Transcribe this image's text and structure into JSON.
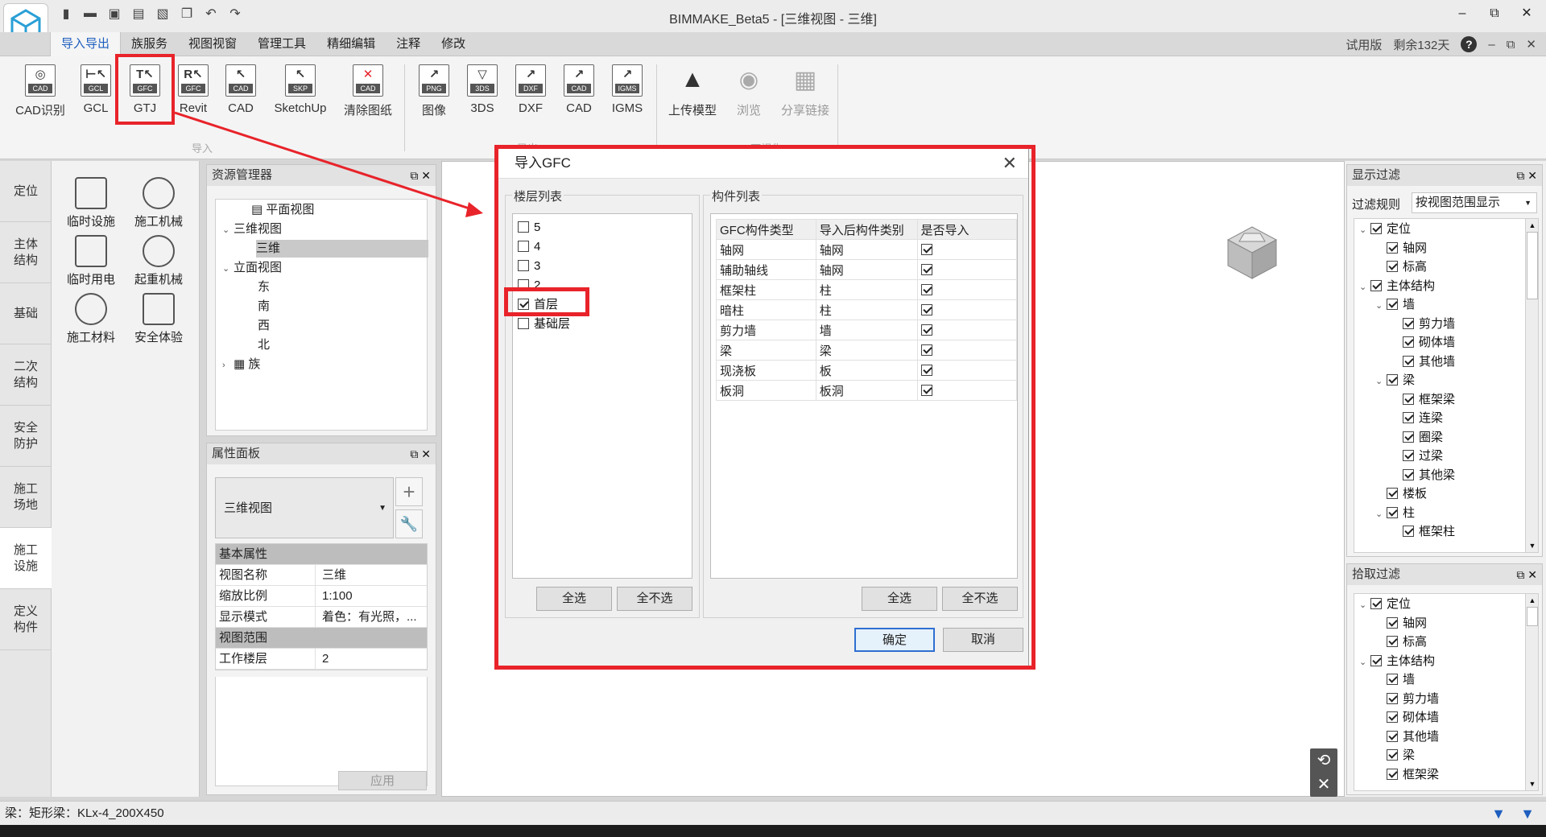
{
  "window": {
    "title": "BIMMAKE_Beta5 - [三维视图 - 三维]",
    "controls": [
      "–",
      "⧉",
      "✕"
    ]
  },
  "ribbon_tabs": [
    "导入导出",
    "族服务",
    "视图视窗",
    "管理工具",
    "精细编辑",
    "注释",
    "修改"
  ],
  "tab_right": {
    "edition": "试用版",
    "days_left": "剩余132天",
    "help": "?",
    "min": "–",
    "restore": "⧉",
    "close": "✕"
  },
  "ribbon_groups": {
    "import": {
      "label": "导入",
      "buttons": [
        {
          "label": "CAD识别",
          "tag": "CAD",
          "glyph": "◎"
        },
        {
          "label": "GCL",
          "tag": "GCL",
          "glyph": "⊢↖"
        },
        {
          "label": "GTJ",
          "tag": "GFC",
          "glyph": "T↖"
        },
        {
          "label": "Revit",
          "tag": "GFC",
          "glyph": "R↖"
        },
        {
          "label": "CAD",
          "tag": "CAD",
          "glyph": "↖"
        },
        {
          "label": "SketchUp",
          "tag": "SKP",
          "glyph": "↖"
        },
        {
          "label": "清除图纸",
          "tag": "CAD",
          "glyph": "✕"
        }
      ]
    },
    "export": {
      "label": "导出",
      "buttons": [
        {
          "label": "图像",
          "tag": "PNG",
          "glyph": "↗"
        },
        {
          "label": "3DS",
          "tag": "3DS",
          "glyph": "▽"
        },
        {
          "label": "DXF",
          "tag": "DXF",
          "glyph": "↗"
        },
        {
          "label": "CAD",
          "tag": "CAD",
          "glyph": "↗"
        },
        {
          "label": "IGMS",
          "tag": "IGMS",
          "glyph": "↗"
        }
      ]
    },
    "bimface": {
      "label": "BIMFACE可视化",
      "buttons": [
        {
          "label": "上传模型",
          "glyph": "▲"
        },
        {
          "label": "浏览",
          "glyph": "◉"
        },
        {
          "label": "分享链接",
          "glyph": "▦"
        }
      ]
    }
  },
  "left_tabs": [
    "定位",
    "主体\n结构",
    "基础",
    "二次\n结构",
    "安全\n防护",
    "施工\n场地",
    "施工\n设施",
    "定义\n构件"
  ],
  "tools": [
    "临时设施",
    "施工机械",
    "临时用电",
    "起重机械",
    "施工材料",
    "安全体验"
  ],
  "resource_manager": {
    "title": "资源管理器",
    "buttons": "⧉ ✕",
    "nodes": [
      {
        "label": "平面视图",
        "arrow": ""
      },
      {
        "label": "三维视图",
        "arrow": "⌄"
      },
      {
        "label": "三维",
        "arrow": ""
      },
      {
        "label": "立面视图",
        "arrow": "⌄"
      },
      {
        "label": "东",
        "arrow": ""
      },
      {
        "label": "南",
        "arrow": ""
      },
      {
        "label": "西",
        "arrow": ""
      },
      {
        "label": "北",
        "arrow": ""
      },
      {
        "label": "族",
        "arrow": "›"
      }
    ]
  },
  "properties": {
    "title": "属性面板",
    "buttons": "⧉ ✕",
    "view_select": "三维视图",
    "add": "+",
    "tool": "🔧",
    "section_basic": "基本属性",
    "rows": [
      {
        "k": "视图名称",
        "v": "三维"
      },
      {
        "k": "缩放比例",
        "v": "1:100"
      },
      {
        "k": "显示模式",
        "v": "着色：有光照，..."
      }
    ],
    "section_range": "视图范围",
    "rows2": [
      {
        "k": "工作楼层",
        "v": "2"
      }
    ],
    "apply": "应用"
  },
  "display_filter": {
    "title": "显示过滤",
    "buttons": "⧉ ✕",
    "rule_label": "过滤规则",
    "rule_value": "按视图范围显示",
    "nodes": [
      {
        "label": "定位",
        "arrow": "⌄"
      },
      {
        "label": "轴网",
        "arrow": ""
      },
      {
        "label": "标高",
        "arrow": ""
      },
      {
        "label": "主体结构",
        "arrow": "⌄"
      },
      {
        "label": "墙",
        "arrow": "⌄"
      },
      {
        "label": "剪力墙",
        "arrow": ""
      },
      {
        "label": "砌体墙",
        "arrow": ""
      },
      {
        "label": "其他墙",
        "arrow": ""
      },
      {
        "label": "梁",
        "arrow": "⌄"
      },
      {
        "label": "框架梁",
        "arrow": ""
      },
      {
        "label": "连梁",
        "arrow": ""
      },
      {
        "label": "圈梁",
        "arrow": ""
      },
      {
        "label": "过梁",
        "arrow": ""
      },
      {
        "label": "其他梁",
        "arrow": ""
      },
      {
        "label": "楼板",
        "arrow": ""
      },
      {
        "label": "柱",
        "arrow": "⌄"
      },
      {
        "label": "框架柱",
        "arrow": ""
      }
    ]
  },
  "pick_filter": {
    "title": "拾取过滤",
    "buttons": "⧉ ✕",
    "nodes": [
      {
        "label": "定位",
        "arrow": "⌄"
      },
      {
        "label": "轴网",
        "arrow": ""
      },
      {
        "label": "标高",
        "arrow": ""
      },
      {
        "label": "主体结构",
        "arrow": "⌄"
      },
      {
        "label": "墙",
        "arrow": ""
      },
      {
        "label": "剪力墙",
        "arrow": ""
      },
      {
        "label": "砌体墙",
        "arrow": ""
      },
      {
        "label": "其他墙",
        "arrow": ""
      },
      {
        "label": "梁",
        "arrow": ""
      },
      {
        "label": "框架梁",
        "arrow": ""
      }
    ]
  },
  "dialog": {
    "title": "导入GFC",
    "close": "✕",
    "floor_list_label": "楼层列表",
    "floors": [
      {
        "label": "5",
        "checked": false
      },
      {
        "label": "4",
        "checked": false
      },
      {
        "label": "3",
        "checked": false
      },
      {
        "label": "2",
        "checked": false
      },
      {
        "label": "首层",
        "checked": true
      },
      {
        "label": "基础层",
        "checked": false
      }
    ],
    "component_list_label": "构件列表",
    "columns": [
      "GFC构件类型",
      "导入后构件类别",
      "是否导入"
    ],
    "rows": [
      [
        "轴网",
        "轴网",
        true
      ],
      [
        "辅助轴线",
        "轴网",
        true
      ],
      [
        "框架柱",
        "柱",
        true
      ],
      [
        "暗柱",
        "柱",
        true
      ],
      [
        "剪力墙",
        "墙",
        true
      ],
      [
        "梁",
        "梁",
        true
      ],
      [
        "现浇板",
        "板",
        true
      ],
      [
        "板洞",
        "板洞",
        true
      ]
    ],
    "select_all": "全选",
    "select_none": "全不选",
    "ok": "确定",
    "cancel": "取消"
  },
  "status": {
    "text": "梁：矩形梁：KLx-4_200X450"
  },
  "nav": {
    "rotate": "⟲",
    "close": "✕"
  },
  "colors": {
    "accent": "#1e5fbf",
    "highlight": "#e8232a"
  }
}
